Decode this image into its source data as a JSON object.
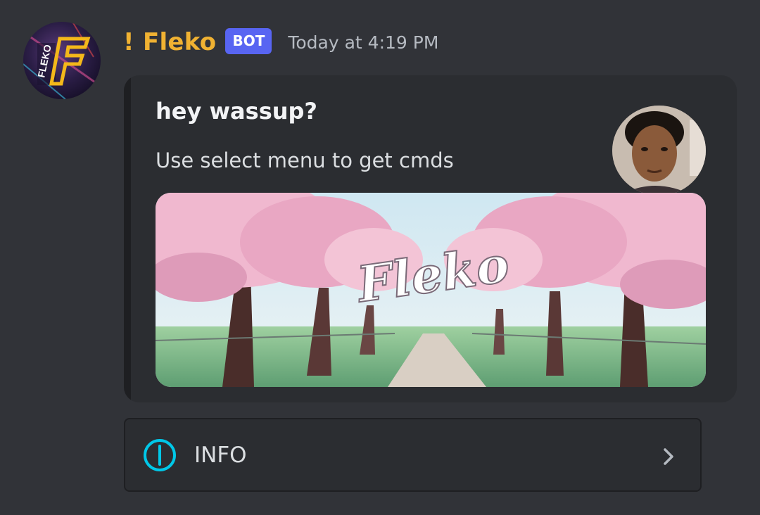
{
  "message": {
    "author": {
      "username": "! Fleko",
      "badge": "BOT",
      "timestamp": "Today at 4:19 PM",
      "avatar_icon": "fleko-logo-icon"
    },
    "embed": {
      "title": "hey wassup?",
      "description": "Use select menu to get cmds",
      "thumbnail": "user-photo",
      "image": {
        "description": "cherry-blossom-banner",
        "text": "Fleko"
      }
    }
  },
  "select_menu": {
    "icon": "info-icon",
    "label": "INFO",
    "chevron_icon": "chevron-right-icon"
  },
  "colors": {
    "background": "#313338",
    "embed_background": "#2b2d31",
    "username": "#f0b232",
    "badge": "#5865f2",
    "timestamp": "#b5bac1",
    "info_icon": "#00c8e8"
  }
}
